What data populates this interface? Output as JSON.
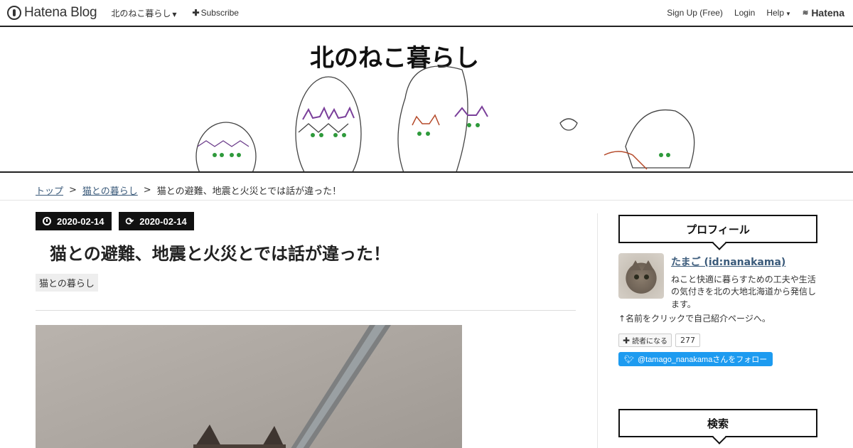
{
  "topbar": {
    "logo_text": "Hatena Blog",
    "blog_name": "北のねこ暮らし",
    "subscribe": "Subscribe",
    "signup": "Sign Up (Free)",
    "login": "Login",
    "help": "Help",
    "brand": "Hatena"
  },
  "header": {
    "title": "北のねこ暮らし"
  },
  "breadcrumb": {
    "items": [
      "トップ",
      "猫との暮らし",
      "猫との避難、地震と火災とでは話が違った！"
    ],
    "separator": ">"
  },
  "entry": {
    "published_date": "2020-02-14",
    "updated_date": "2020-02-14",
    "title": "猫との避難、地震と火災とでは話が違った！",
    "category": "猫との暮らし"
  },
  "sidebar": {
    "profile_title": "プロフィール",
    "profile_name": "たまご (id:nanakama)",
    "profile_desc": "ねこと快適に暮らすための工夫や生活の気付きを北の大地北海道から発信します。",
    "profile_note": "↑名前をクリックで自己紹介ページへ。",
    "reader_button": "読者になる",
    "reader_count": "277",
    "twitter_button": "@tamago_nanakamaさんをフォロー",
    "search_title": "検索"
  },
  "colors": {
    "link": "#3a5a7a",
    "twitter": "#1d9bf0",
    "badge_bg": "#111111"
  }
}
